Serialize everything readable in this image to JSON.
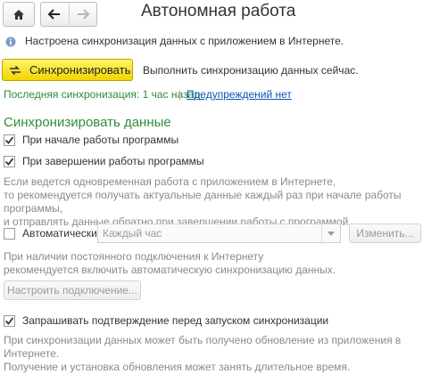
{
  "window": {
    "title": "Автономная работа"
  },
  "info": {
    "text": "Настроена синхронизация данных с приложением в Интернете."
  },
  "sync": {
    "button_label": "Синхронизировать",
    "description": "Выполнить синхронизацию данных сейчас.",
    "last_sync": "Последняя синхронизация: 1 час назад.",
    "separator": "|",
    "warnings_link": "Предупреждений нет"
  },
  "section": {
    "title": "Синхронизировать данные",
    "on_start": {
      "label": "При начале работы программы",
      "checked": true
    },
    "on_exit": {
      "label": "При завершении работы программы",
      "checked": true
    },
    "hint1": [
      "Если ведется одновременная работа с приложением в Интернете,",
      "то рекомендуется получать актуальные данные каждый раз при начале работы программы,",
      "и отправлять данные обратно при завершении работы с программой."
    ],
    "auto": {
      "label": "Автоматически:",
      "checked": false,
      "select_value": "Каждый час",
      "change_button": "Изменить..."
    },
    "hint2": [
      "При наличии постоянного подключения к Интернету",
      "рекомендуется включить автоматическую синхронизацию данных."
    ],
    "configure_button": "Настроить подключение...",
    "confirm": {
      "label": "Запрашивать подтверждение перед запуском синхронизации",
      "checked": true
    },
    "hint3": [
      "При синхронизации данных может быть получено обновление из приложения в Интернете.",
      "Получение и установка обновления может занять длительное время."
    ]
  }
}
